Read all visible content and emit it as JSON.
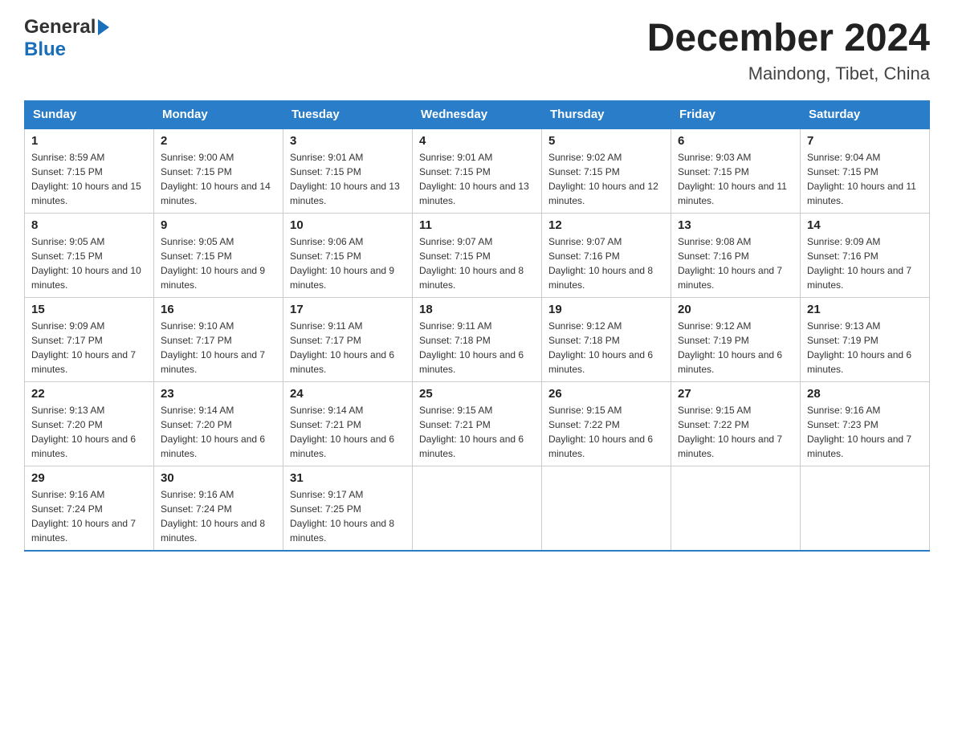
{
  "header": {
    "logo_general": "General",
    "logo_blue": "Blue",
    "month_title": "December 2024",
    "location": "Maindong, Tibet, China"
  },
  "days_of_week": [
    "Sunday",
    "Monday",
    "Tuesday",
    "Wednesday",
    "Thursday",
    "Friday",
    "Saturday"
  ],
  "weeks": [
    [
      {
        "day": "1",
        "sunrise": "8:59 AM",
        "sunset": "7:15 PM",
        "daylight": "10 hours and 15 minutes."
      },
      {
        "day": "2",
        "sunrise": "9:00 AM",
        "sunset": "7:15 PM",
        "daylight": "10 hours and 14 minutes."
      },
      {
        "day": "3",
        "sunrise": "9:01 AM",
        "sunset": "7:15 PM",
        "daylight": "10 hours and 13 minutes."
      },
      {
        "day": "4",
        "sunrise": "9:01 AM",
        "sunset": "7:15 PM",
        "daylight": "10 hours and 13 minutes."
      },
      {
        "day": "5",
        "sunrise": "9:02 AM",
        "sunset": "7:15 PM",
        "daylight": "10 hours and 12 minutes."
      },
      {
        "day": "6",
        "sunrise": "9:03 AM",
        "sunset": "7:15 PM",
        "daylight": "10 hours and 11 minutes."
      },
      {
        "day": "7",
        "sunrise": "9:04 AM",
        "sunset": "7:15 PM",
        "daylight": "10 hours and 11 minutes."
      }
    ],
    [
      {
        "day": "8",
        "sunrise": "9:05 AM",
        "sunset": "7:15 PM",
        "daylight": "10 hours and 10 minutes."
      },
      {
        "day": "9",
        "sunrise": "9:05 AM",
        "sunset": "7:15 PM",
        "daylight": "10 hours and 9 minutes."
      },
      {
        "day": "10",
        "sunrise": "9:06 AM",
        "sunset": "7:15 PM",
        "daylight": "10 hours and 9 minutes."
      },
      {
        "day": "11",
        "sunrise": "9:07 AM",
        "sunset": "7:15 PM",
        "daylight": "10 hours and 8 minutes."
      },
      {
        "day": "12",
        "sunrise": "9:07 AM",
        "sunset": "7:16 PM",
        "daylight": "10 hours and 8 minutes."
      },
      {
        "day": "13",
        "sunrise": "9:08 AM",
        "sunset": "7:16 PM",
        "daylight": "10 hours and 7 minutes."
      },
      {
        "day": "14",
        "sunrise": "9:09 AM",
        "sunset": "7:16 PM",
        "daylight": "10 hours and 7 minutes."
      }
    ],
    [
      {
        "day": "15",
        "sunrise": "9:09 AM",
        "sunset": "7:17 PM",
        "daylight": "10 hours and 7 minutes."
      },
      {
        "day": "16",
        "sunrise": "9:10 AM",
        "sunset": "7:17 PM",
        "daylight": "10 hours and 7 minutes."
      },
      {
        "day": "17",
        "sunrise": "9:11 AM",
        "sunset": "7:17 PM",
        "daylight": "10 hours and 6 minutes."
      },
      {
        "day": "18",
        "sunrise": "9:11 AM",
        "sunset": "7:18 PM",
        "daylight": "10 hours and 6 minutes."
      },
      {
        "day": "19",
        "sunrise": "9:12 AM",
        "sunset": "7:18 PM",
        "daylight": "10 hours and 6 minutes."
      },
      {
        "day": "20",
        "sunrise": "9:12 AM",
        "sunset": "7:19 PM",
        "daylight": "10 hours and 6 minutes."
      },
      {
        "day": "21",
        "sunrise": "9:13 AM",
        "sunset": "7:19 PM",
        "daylight": "10 hours and 6 minutes."
      }
    ],
    [
      {
        "day": "22",
        "sunrise": "9:13 AM",
        "sunset": "7:20 PM",
        "daylight": "10 hours and 6 minutes."
      },
      {
        "day": "23",
        "sunrise": "9:14 AM",
        "sunset": "7:20 PM",
        "daylight": "10 hours and 6 minutes."
      },
      {
        "day": "24",
        "sunrise": "9:14 AM",
        "sunset": "7:21 PM",
        "daylight": "10 hours and 6 minutes."
      },
      {
        "day": "25",
        "sunrise": "9:15 AM",
        "sunset": "7:21 PM",
        "daylight": "10 hours and 6 minutes."
      },
      {
        "day": "26",
        "sunrise": "9:15 AM",
        "sunset": "7:22 PM",
        "daylight": "10 hours and 6 minutes."
      },
      {
        "day": "27",
        "sunrise": "9:15 AM",
        "sunset": "7:22 PM",
        "daylight": "10 hours and 7 minutes."
      },
      {
        "day": "28",
        "sunrise": "9:16 AM",
        "sunset": "7:23 PM",
        "daylight": "10 hours and 7 minutes."
      }
    ],
    [
      {
        "day": "29",
        "sunrise": "9:16 AM",
        "sunset": "7:24 PM",
        "daylight": "10 hours and 7 minutes."
      },
      {
        "day": "30",
        "sunrise": "9:16 AM",
        "sunset": "7:24 PM",
        "daylight": "10 hours and 8 minutes."
      },
      {
        "day": "31",
        "sunrise": "9:17 AM",
        "sunset": "7:25 PM",
        "daylight": "10 hours and 8 minutes."
      },
      null,
      null,
      null,
      null
    ]
  ]
}
